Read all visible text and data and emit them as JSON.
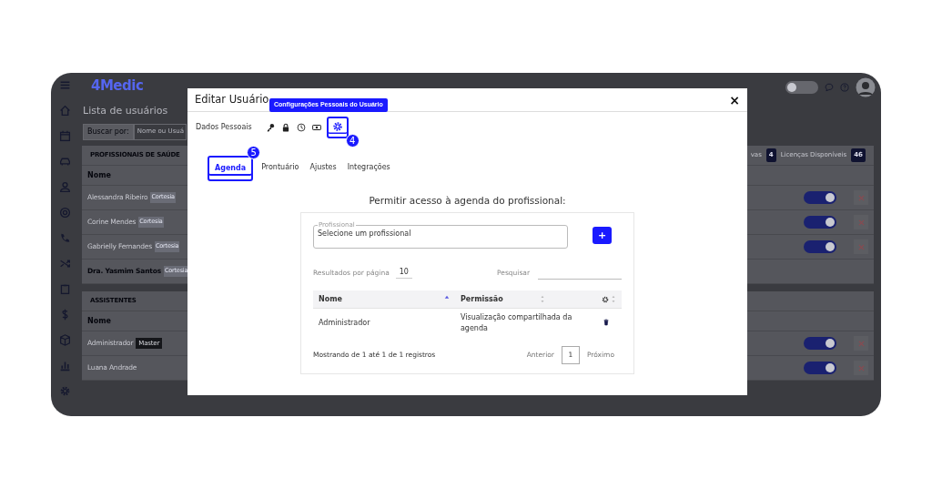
{
  "app": {
    "logo": "4Medic",
    "page_title": "Lista de usuários",
    "search": {
      "label": "Buscar por:",
      "placeholder": "Nome ou Usuá"
    },
    "theme_toggle": {
      "on": false
    },
    "licenses": [
      {
        "label": "vas",
        "count": "4"
      },
      {
        "label": "Licenças Disponíveis",
        "count": "46"
      }
    ],
    "sections": [
      {
        "title": "PROFISSIONAIS DE SAÚDE",
        "column": "Nome",
        "rows": [
          {
            "name": "Alessandra Ribeiro",
            "tag": {
              "label": "Cortesia",
              "kind": "light"
            },
            "bold": false,
            "active": true
          },
          {
            "name": "Corine Mendes",
            "tag": {
              "label": "Cortesia",
              "kind": "light"
            },
            "bold": false,
            "active": true
          },
          {
            "name": "Gabrielly Fernandes",
            "tag": {
              "label": "Cortesia",
              "kind": "light"
            },
            "bold": false,
            "active": true
          },
          {
            "name": "Dra. Yasmim Santos",
            "tag": {
              "label": "Cortesia",
              "kind": "light"
            },
            "bold": true
          }
        ]
      },
      {
        "title": "ASSISTENTES",
        "column": "Nome",
        "rows": [
          {
            "name": "Administrador",
            "tag": {
              "label": "Master",
              "kind": "dark"
            },
            "bold": false,
            "active": true
          },
          {
            "name": "Luana Andrade",
            "bold": false,
            "active": true
          }
        ]
      }
    ]
  },
  "modal": {
    "title": "Editar Usuário",
    "close": "×",
    "tooltip": "Configurações Pessoais do Usuário",
    "icon_tabs": [
      {
        "kind": "text",
        "label": "Dados Pessoais",
        "selected": false
      },
      {
        "kind": "key",
        "selected": false
      },
      {
        "kind": "lock",
        "selected": false
      },
      {
        "kind": "clock",
        "selected": false
      },
      {
        "kind": "money",
        "selected": false
      },
      {
        "kind": "gear",
        "selected": true,
        "callout": "4"
      }
    ],
    "tabs": [
      {
        "label": "Agenda",
        "selected": true,
        "callout": "5"
      },
      {
        "label": "Prontuário",
        "selected": false
      },
      {
        "label": "Ajustes",
        "selected": false
      },
      {
        "label": "Integrações",
        "selected": false
      }
    ],
    "heading": "Permitir acesso à agenda do profissional:",
    "professional_field": {
      "label": "Profissional",
      "value": "Selecione um profissional"
    },
    "add_button": "+",
    "page_size": {
      "label": "Resultados por página",
      "value": "10"
    },
    "search": {
      "label": "Pesquisar"
    },
    "table": {
      "columns": [
        {
          "kind": "text",
          "label": "Nome",
          "sorted": true
        },
        {
          "kind": "text",
          "label": "Permissão",
          "sorted": false
        },
        {
          "kind": "settings",
          "sorted": false
        }
      ],
      "rows": [
        {
          "cells": [
            "Administrador",
            "Visualização compartilhada da agenda"
          ]
        }
      ]
    },
    "info": "Mostrando de 1 até 1 de 1 registros",
    "pagination": {
      "previous": "Anterior",
      "page": "1",
      "next": "Próximo"
    }
  }
}
